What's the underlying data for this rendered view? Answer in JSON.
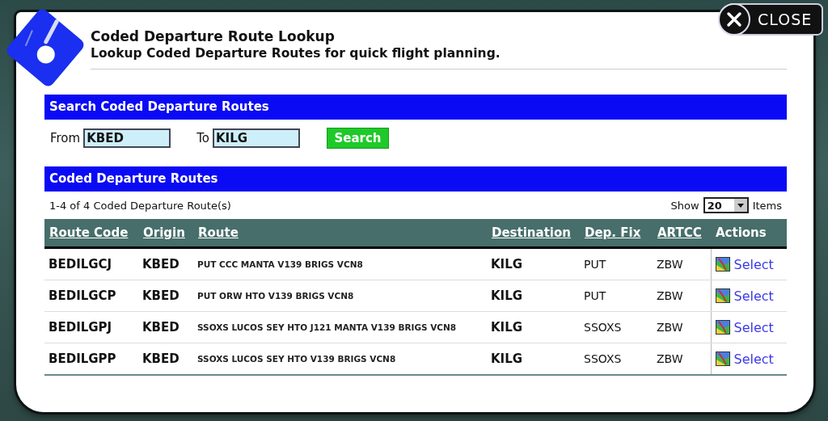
{
  "dialog": {
    "title": "Coded Departure Route Lookup",
    "subtitle": "Lookup Coded Departure Routes for quick flight planning."
  },
  "close_button": {
    "label": "CLOSE"
  },
  "search": {
    "heading": "Search Coded Departure Routes",
    "from_label": "From",
    "from_value": "KBED",
    "to_label": "To",
    "to_value": "KILG",
    "button": "Search"
  },
  "results": {
    "heading": "Coded Departure Routes",
    "count": "1-4 of 4 Coded Departure Route(s)",
    "show_label": "Show",
    "page_size": "20",
    "items_label": "Items",
    "columns": [
      {
        "label": "Route Code",
        "sortable": true
      },
      {
        "label": "Origin",
        "sortable": true
      },
      {
        "label": "Route",
        "sortable": true
      },
      {
        "label": "Destination",
        "sortable": true
      },
      {
        "label": "Dep. Fix",
        "sortable": true
      },
      {
        "label": "ARTCC",
        "sortable": true
      },
      {
        "label": "Actions",
        "sortable": false
      }
    ],
    "rows": [
      {
        "cells": [
          "BEDILGCJ",
          "KBED",
          "PUT CCC MANTA V139 BRIGS VCN8",
          "KILG",
          "PUT",
          "ZBW"
        ],
        "action": "Select"
      },
      {
        "cells": [
          "BEDILGCP",
          "KBED",
          "PUT ORW HTO V139 BRIGS VCN8",
          "KILG",
          "PUT",
          "ZBW"
        ],
        "action": "Select"
      },
      {
        "cells": [
          "BEDILGPJ",
          "KBED",
          "SSOXS LUCOS SEY HTO J121 MANTA V139 BRIGS VCN8",
          "KILG",
          "SSOXS",
          "ZBW"
        ],
        "action": "Select"
      },
      {
        "cells": [
          "BEDILGPP",
          "KBED",
          "SSOXS LUCOS SEY HTO V139 BRIGS VCN8",
          "KILG",
          "SSOXS",
          "ZBW"
        ],
        "action": "Select"
      }
    ]
  }
}
